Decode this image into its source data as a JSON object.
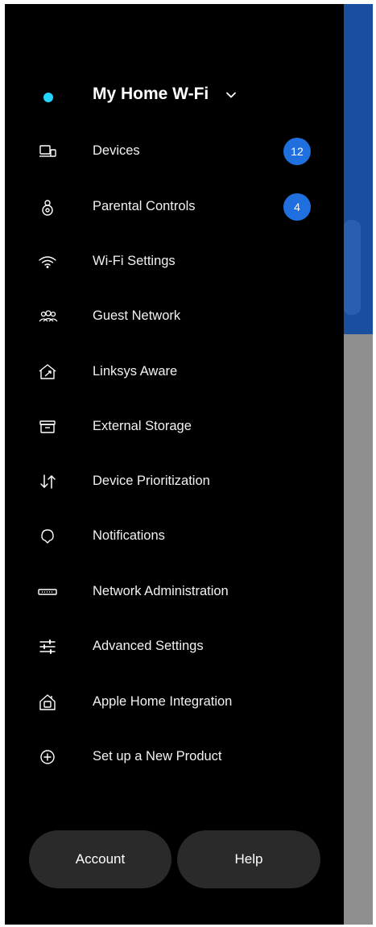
{
  "header": {
    "network_name": "My Home W-Fi"
  },
  "menu": [
    {
      "label": "Devices",
      "icon": "devices-icon",
      "badge": "12"
    },
    {
      "label": "Parental Controls",
      "icon": "parental-controls-icon",
      "badge": "4"
    },
    {
      "label": "Wi-Fi Settings",
      "icon": "wifi-icon"
    },
    {
      "label": "Guest Network",
      "icon": "guest-network-icon"
    },
    {
      "label": "Linksys Aware",
      "icon": "linksys-aware-icon"
    },
    {
      "label": "External Storage",
      "icon": "external-storage-icon"
    },
    {
      "label": "Device Prioritization",
      "icon": "prioritization-arrows-icon"
    },
    {
      "label": "Notifications",
      "icon": "notification-bell-icon"
    },
    {
      "label": "Network Administration",
      "icon": "router-icon"
    },
    {
      "label": "Advanced Settings",
      "icon": "sliders-icon"
    },
    {
      "label": "Apple Home Integration",
      "icon": "apple-home-icon"
    },
    {
      "label": "Set up a New Product",
      "icon": "add-circle-icon"
    }
  ],
  "footer": {
    "account_label": "Account",
    "help_label": "Help"
  },
  "colors": {
    "drawer_bg": "#000000",
    "badge": "#1f6fde",
    "status_dot": "#23d5ff",
    "background_blue": "#1a4fa0"
  }
}
